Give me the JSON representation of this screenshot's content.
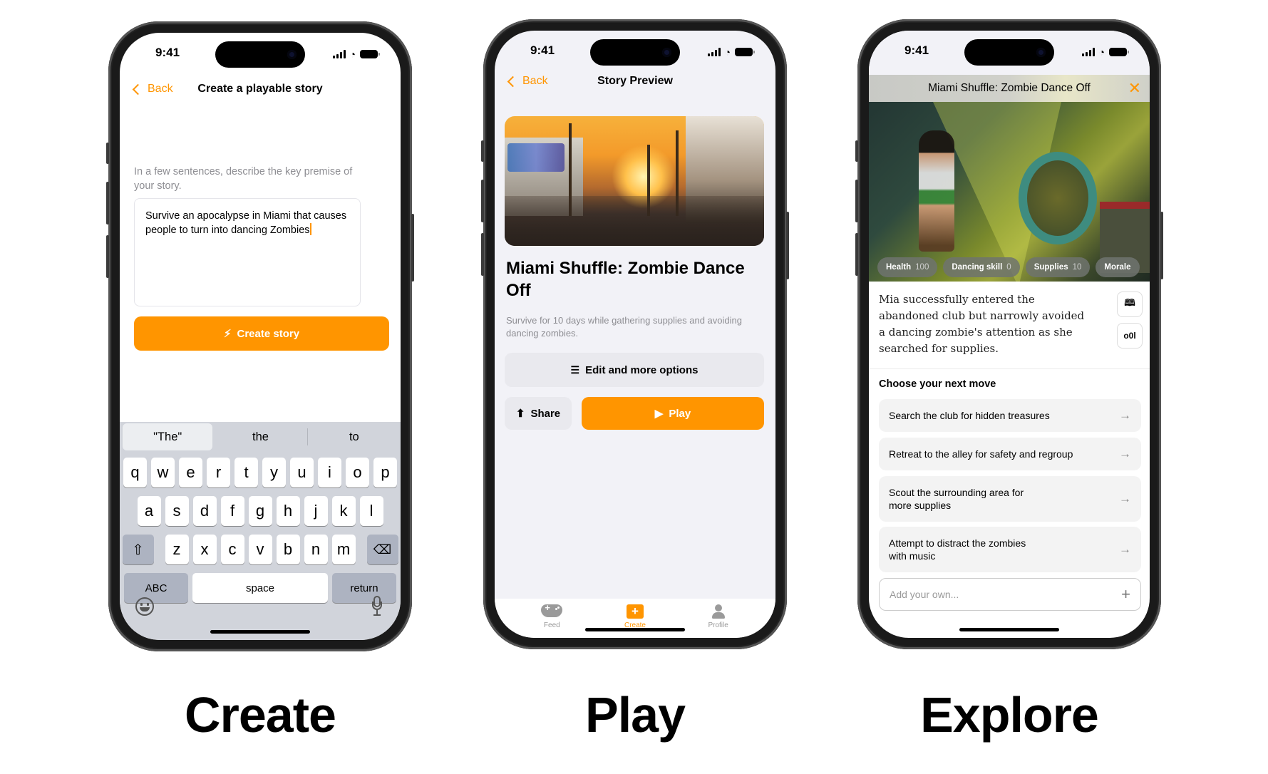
{
  "status": {
    "time": "9:41"
  },
  "captions": {
    "create": "Create",
    "play": "Play",
    "explore": "Explore"
  },
  "create_screen": {
    "back_label": "Back",
    "title": "Create a playable story",
    "hint": "In a few sentences, describe the key premise of your story.",
    "premise_value": "Survive an apocalypse in Miami that causes people to turn into dancing Zombies",
    "create_button": "Create story",
    "keyboard": {
      "suggestions": [
        "\"The\"",
        "the",
        "to"
      ],
      "row1": [
        "q",
        "w",
        "e",
        "r",
        "t",
        "y",
        "u",
        "i",
        "o",
        "p"
      ],
      "row2": [
        "a",
        "s",
        "d",
        "f",
        "g",
        "h",
        "j",
        "k",
        "l"
      ],
      "row3": [
        "z",
        "x",
        "c",
        "v",
        "b",
        "n",
        "m"
      ],
      "abc": "ABC",
      "space": "space",
      "return": "return"
    }
  },
  "play_screen": {
    "back_label": "Back",
    "title": "Story Preview",
    "story_title": "Miami Shuffle: Zombie Dance Off",
    "story_description": "Survive for 10 days while gathering supplies and avoiding dancing zombies.",
    "edit_button": "Edit and more options",
    "share_button": "Share",
    "play_button": "Play",
    "tabs": [
      {
        "label": "Feed",
        "icon": "gamepad-icon"
      },
      {
        "label": "Create",
        "icon": "plus-square-icon",
        "active": true
      },
      {
        "label": "Profile",
        "icon": "person-icon"
      }
    ]
  },
  "explore_screen": {
    "title": "Miami Shuffle: Zombie Dance Off",
    "stats": [
      {
        "name": "Health",
        "value": "100"
      },
      {
        "name": "Dancing skill",
        "value": "0"
      },
      {
        "name": "Supplies",
        "value": "10"
      },
      {
        "name": "Morale",
        "value": ""
      }
    ],
    "narration": "Mia successfully entered the abandoned club but narrowly avoided a dancing zombie's attention as she searched for supplies.",
    "choose_heading": "Choose your next move",
    "choices": [
      "Search the club for hidden treasures",
      "Retreat to the alley for safety and regroup",
      "Scout the surrounding area for more supplies",
      "Attempt to distract the zombies with music"
    ],
    "add_own_placeholder": "Add your own..."
  },
  "colors": {
    "accent": "#ff9500"
  }
}
